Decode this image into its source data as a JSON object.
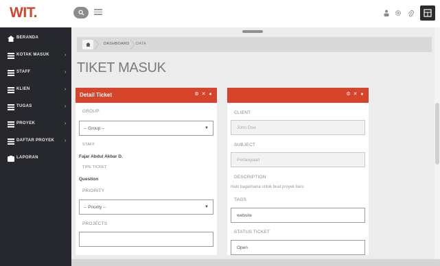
{
  "brand": {
    "logo": "WIT.",
    "accent": "#d6452b"
  },
  "topbar": {
    "icons": [
      "search-icon",
      "menu-icon",
      "user-icon",
      "gear-icon",
      "clip-icon",
      "grid-icon"
    ]
  },
  "sidebar": {
    "items": [
      {
        "label": "BERANDA",
        "icon": "home-icon",
        "has_arrow": false
      },
      {
        "label": "KOTAK MASUK",
        "icon": "list-icon",
        "has_arrow": true
      },
      {
        "label": "STAFF",
        "icon": "list-icon",
        "has_arrow": true
      },
      {
        "label": "KLIEN",
        "icon": "list-icon",
        "has_arrow": true
      },
      {
        "label": "TUGAS",
        "icon": "list-icon",
        "has_arrow": true
      },
      {
        "label": "PROYEK",
        "icon": "list-icon",
        "has_arrow": true
      },
      {
        "label": "DAFTAR PROYEK",
        "icon": "list-icon",
        "has_arrow": true
      },
      {
        "label": "LAPORAN",
        "icon": "report-icon",
        "has_arrow": false
      }
    ]
  },
  "breadcrumb": {
    "items": [
      "DASHBOARD",
      "DATA"
    ]
  },
  "page": {
    "title": "TIKET MASUK"
  },
  "left_panel": {
    "title": "Detail Ticket",
    "group_label": "GROUP",
    "group_value": "-- Group --",
    "staff_label": "STAFF",
    "staff_value": "Fajar Abdul Akbar D.",
    "type_label": "TIPE TICKET",
    "type_value": "Question",
    "priority_label": "PRIORITY",
    "priority_value": "-- Priority --",
    "projects_label": "PROJECTS",
    "projects_value": ""
  },
  "right_panel": {
    "title": "",
    "client_label": "CLIENT",
    "client_value": "John Doe",
    "subject_label": "SUBJECT",
    "subject_value": "Pertanyaan",
    "description_label": "DESCRIPTION",
    "description_value": "Halo bagaimana untuk buat proyek baru",
    "tags_label": "TAGS",
    "tags_value": "website",
    "status_label": "STATUS TICKET",
    "status_value": "Open"
  }
}
